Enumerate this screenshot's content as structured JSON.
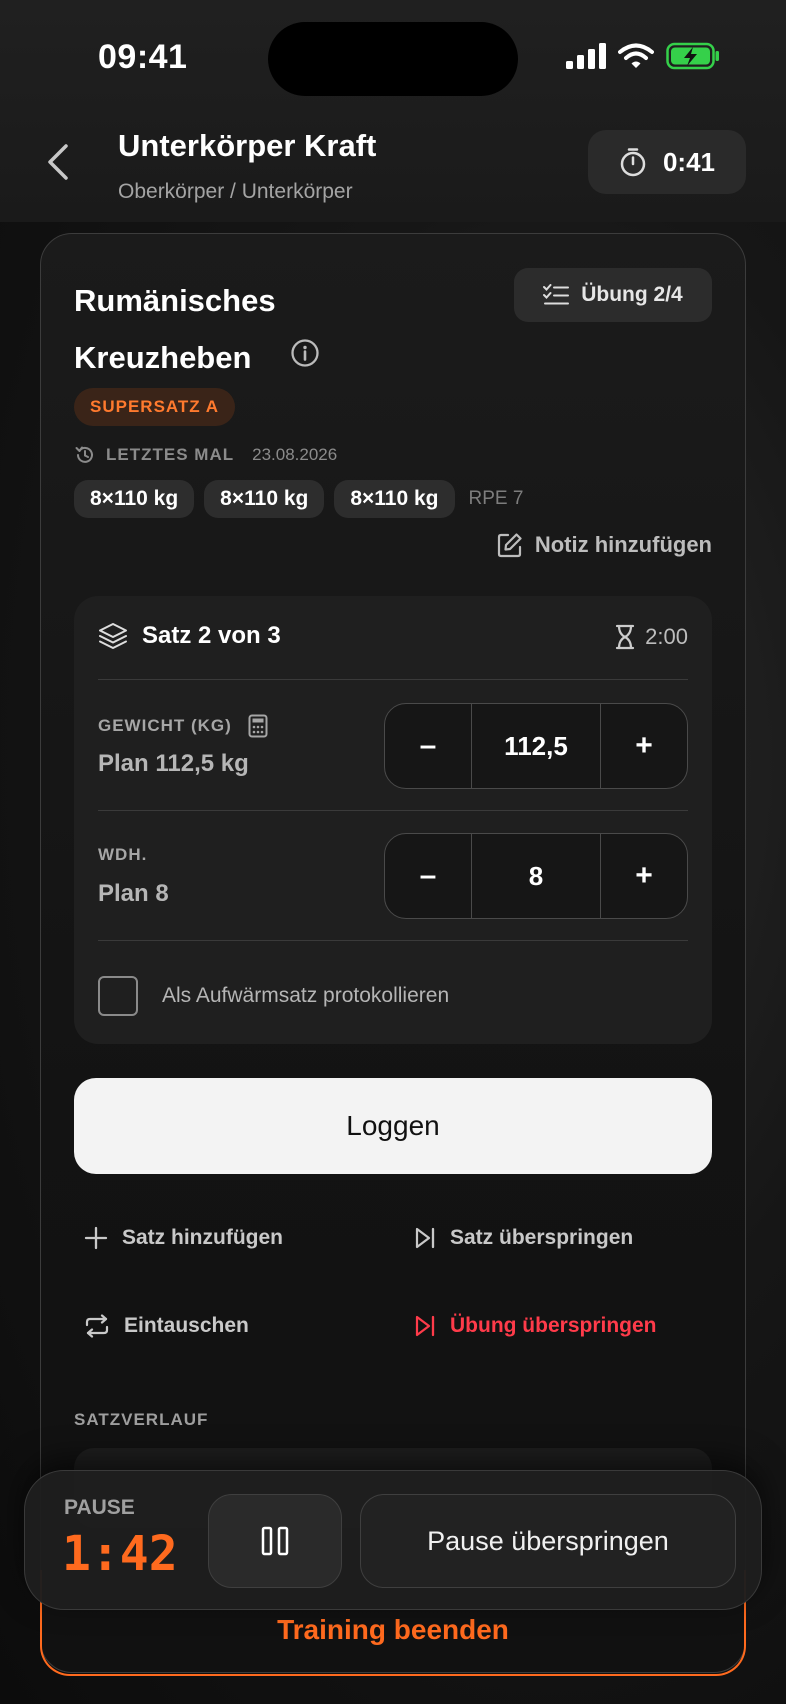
{
  "status": {
    "time": "09:41"
  },
  "header": {
    "title": "Unterkörper Kraft",
    "subtitle": "Oberkörper / Unterkörper",
    "timer": "0:41"
  },
  "exercise": {
    "name": "Rumänisches Kreuzheben",
    "progress": "Übung 2/4",
    "superset": "SUPERSATZ A",
    "last_label": "LETZTES MAL",
    "last_date": "23.08.2026",
    "last_sets": [
      "8×110 kg",
      "8×110 kg",
      "8×110 kg"
    ],
    "last_rpe": "RPE 7",
    "note_label": "Notiz hinzufügen"
  },
  "set": {
    "title": "Satz 2 von 3",
    "rest": "2:00",
    "weight_label": "GEWICHT (KG)",
    "weight_plan": "Plan 112,5 kg",
    "weight_value": "112,5",
    "reps_label": "WDH.",
    "reps_plan": "Plan 8",
    "reps_value": "8",
    "minus": "–",
    "plus": "+",
    "warmup_label": "Als Aufwärmsatz protokollieren"
  },
  "actions": {
    "log": "Loggen",
    "add_set": "Satz hinzufügen",
    "skip_set": "Satz überspringen",
    "swap": "Eintauschen",
    "skip_exercise": "Übung überspringen"
  },
  "history": {
    "label": "SATZVERLAUF"
  },
  "pause": {
    "label": "PAUSE",
    "time": "1:42",
    "skip": "Pause überspringen"
  },
  "end_training": "Training beenden",
  "colors": {
    "accent": "#ff6a1e",
    "danger": "#ff3b4a",
    "battery": "#35d04a"
  }
}
